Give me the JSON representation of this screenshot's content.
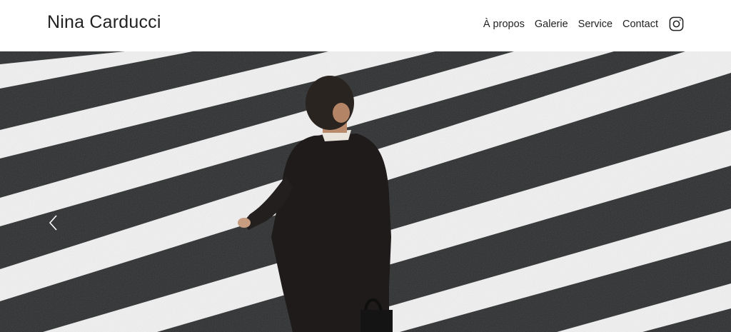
{
  "header": {
    "site_title": "Nina Carducci",
    "nav": [
      {
        "label": "À propos"
      },
      {
        "label": "Galerie"
      },
      {
        "label": "Service"
      },
      {
        "label": "Contact"
      }
    ],
    "social_icon": "instagram-icon"
  },
  "carousel": {
    "image_subject": "businessman-on-crosswalk",
    "prev_icon": "chevron-left-icon"
  },
  "colors": {
    "stripe_white": "#f2f2f2",
    "asphalt": "#2c2e2f",
    "text": "#222222"
  }
}
